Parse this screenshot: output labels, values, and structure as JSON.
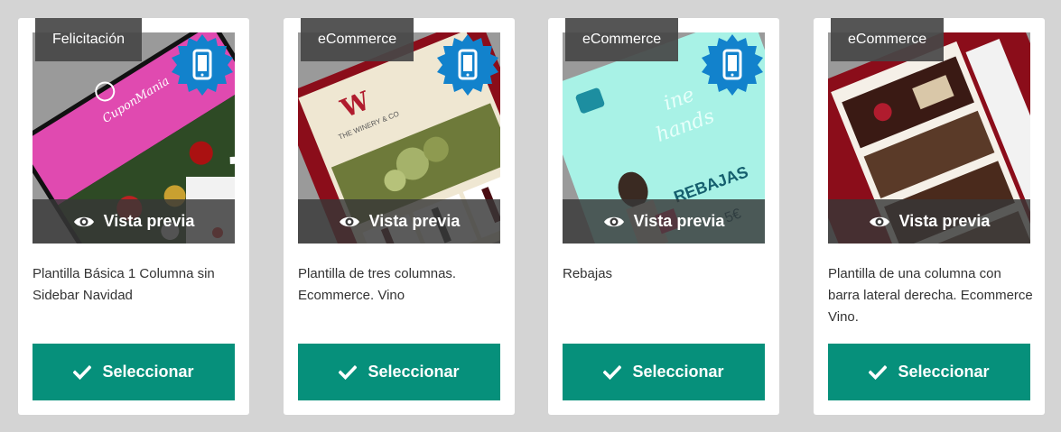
{
  "colors": {
    "background": "#d4d4d4",
    "card": "#ffffff",
    "select_button": "#06907b",
    "mobile_badge": "#1282cc",
    "category_tag": "#464646"
  },
  "icons": {
    "mobile": "smartphone-icon",
    "preview": "eye-icon",
    "select": "checkmark-icon"
  },
  "cards": [
    {
      "category": "Felicitación",
      "preview_label": "Vista previa",
      "description": "Plantilla Básica 1 Columna sin Sidebar Navidad",
      "select_label": "Seleccionar",
      "mobile_ready": true,
      "thumbnail_brand": "CuponMania"
    },
    {
      "category": "eCommerce",
      "preview_label": "Vista previa",
      "description": "Plantilla de tres columnas. Ecommerce. Vino",
      "select_label": "Seleccionar",
      "mobile_ready": true,
      "thumbnail_brand": "THE WINERY & CO"
    },
    {
      "category": "eCommerce",
      "preview_label": "Vista previa",
      "description": "Rebajas",
      "select_label": "Seleccionar",
      "mobile_ready": true,
      "thumbnail_brand": "REBAJAS"
    },
    {
      "category": "eCommerce",
      "preview_label": "Vista previa",
      "description": "Plantilla de una columna con barra lateral derecha. Ecommerce Vino.",
      "select_label": "Seleccionar",
      "mobile_ready": false,
      "thumbnail_brand": ""
    }
  ]
}
